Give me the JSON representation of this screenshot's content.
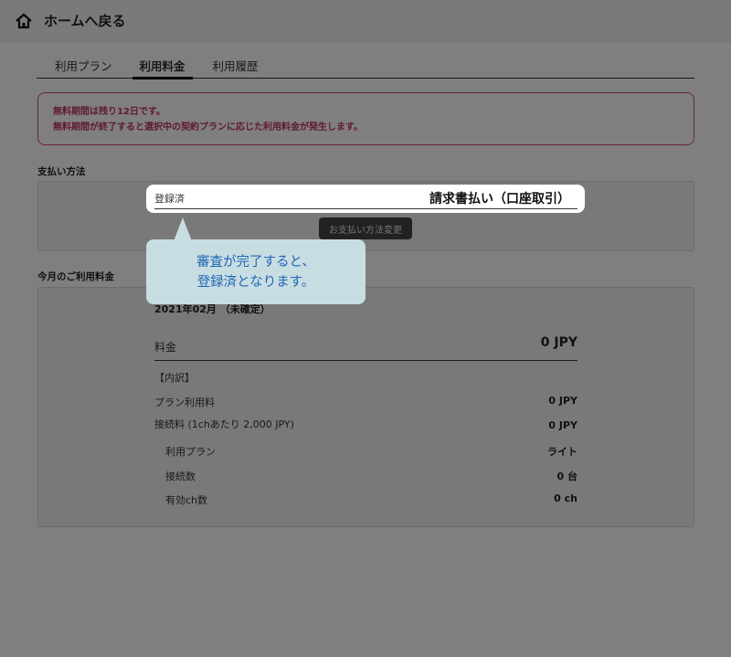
{
  "header": {
    "title": "ホームへ戻る",
    "icon": "home-icon"
  },
  "tabs": [
    {
      "label": "利用プラン",
      "active": false
    },
    {
      "label": "利用料金",
      "active": true
    },
    {
      "label": "利用履歴",
      "active": false
    }
  ],
  "notice": {
    "line1": "無料期間は残り12日です。",
    "line2": "無料期間が終了すると選択中の契約プランに応じた利用料金が発生します。"
  },
  "payment": {
    "section_label": "支払い方法",
    "status": "登録済",
    "method": "請求書払い（口座取引）",
    "change_button": "お支払い方法変更"
  },
  "monthly": {
    "section_label": "今月のご利用料金",
    "period": "2021年02月 （未確定）",
    "fee_label": "料金",
    "fee_value": "0 JPY",
    "breakdown_label": "【内訳】",
    "items": [
      {
        "label": "プラン利用料",
        "value": "0 JPY"
      },
      {
        "label": "接続料 (1chあたり 2,000 JPY)",
        "value": "0 JPY"
      }
    ],
    "sub_items": [
      {
        "label": "利用プラン",
        "value": "ライト"
      },
      {
        "label": "接続数",
        "value": "0 台"
      },
      {
        "label": "有効ch数",
        "value": "0 ch"
      }
    ]
  },
  "tooltip": {
    "line1": "審査が完了すると、",
    "line2": "登録済となります。"
  },
  "colors": {
    "notice_border": "#d14b7a",
    "notice_text": "#c0336a",
    "tooltip_bg": "#c8dde2",
    "tooltip_text": "#1f66b5"
  }
}
